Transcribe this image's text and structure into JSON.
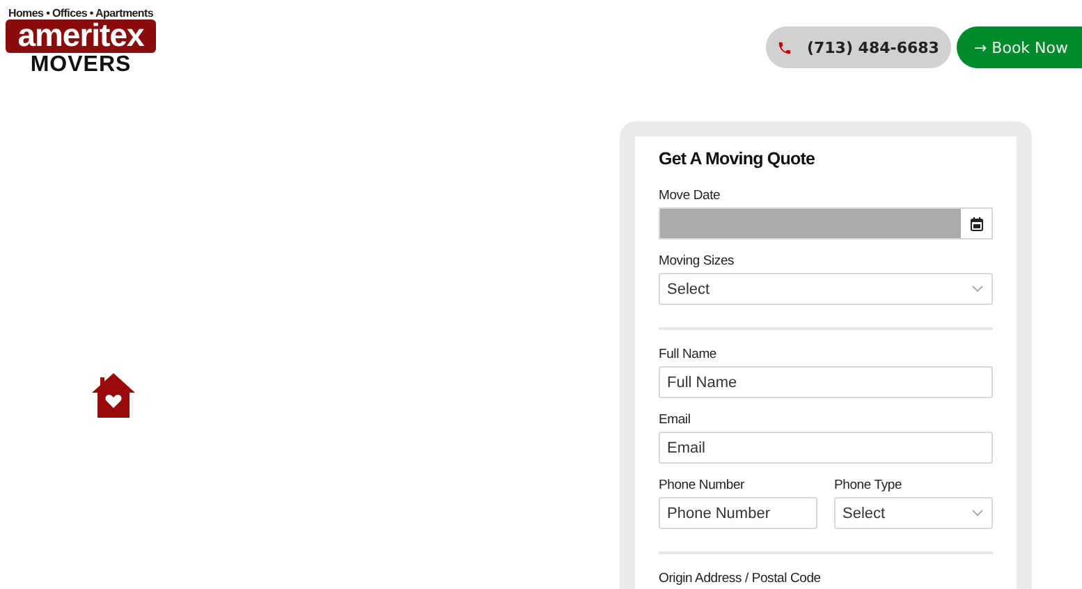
{
  "logo": {
    "tagline": "Homes • Offices • Apartments",
    "name": "ameritex",
    "subname": "MOVERS"
  },
  "header": {
    "phone": "(713) 484-6683",
    "book": "→ Book Now"
  },
  "quote_form": {
    "title": "Get A Moving Quote",
    "rows": [
      {
        "kind": "field",
        "fields": [
          {
            "label": "Move Date",
            "kind": "date"
          }
        ]
      },
      {
        "kind": "field",
        "fields": [
          {
            "label": "Moving Sizes",
            "kind": "select",
            "value": "Select"
          }
        ]
      },
      {
        "kind": "divider"
      },
      {
        "kind": "field",
        "fields": [
          {
            "label": "Full Name",
            "kind": "text",
            "placeholder": "Full Name"
          }
        ]
      },
      {
        "kind": "field",
        "fields": [
          {
            "label": "Email",
            "kind": "text",
            "placeholder": "Email"
          }
        ]
      },
      {
        "kind": "field",
        "fields": [
          {
            "label": "Phone Number",
            "kind": "text",
            "placeholder": "Phone Number"
          },
          {
            "label": "Phone Type",
            "kind": "select",
            "value": "Select"
          }
        ]
      },
      {
        "kind": "divider"
      },
      {
        "kind": "field",
        "fields": [
          {
            "label": "Origin Address / Postal Code",
            "kind": "none"
          }
        ]
      }
    ]
  }
}
